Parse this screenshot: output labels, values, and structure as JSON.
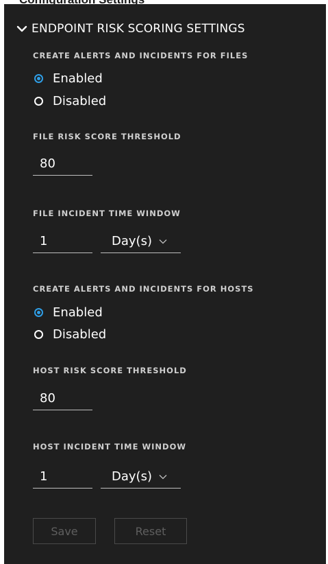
{
  "header": {
    "clipped_text": "Configuration Settings",
    "title": "ENDPOINT RISK SCORING SETTINGS",
    "chevron_icon": "chevron-down-icon"
  },
  "files_alerts": {
    "label": "CREATE ALERTS AND INCIDENTS FOR FILES",
    "options": [
      {
        "label": "Enabled",
        "checked": true
      },
      {
        "label": "Disabled",
        "checked": false
      }
    ]
  },
  "file_threshold": {
    "label": "FILE RISK SCORE THRESHOLD",
    "value": "80"
  },
  "file_window": {
    "label": "FILE INCIDENT TIME WINDOW",
    "value": "1",
    "unit": "Day(s)"
  },
  "hosts_alerts": {
    "label": "CREATE ALERTS AND INCIDENTS FOR HOSTS",
    "options": [
      {
        "label": "Enabled",
        "checked": true
      },
      {
        "label": "Disabled",
        "checked": false
      }
    ]
  },
  "host_threshold": {
    "label": "HOST RISK SCORE THRESHOLD",
    "value": "80"
  },
  "host_window": {
    "label": "HOST INCIDENT TIME WINDOW",
    "value": "1",
    "unit": "Day(s)"
  },
  "buttons": {
    "save": "Save",
    "reset": "Reset",
    "disabled": true
  },
  "colors": {
    "panel_bg": "#1f1f1f",
    "accent": "#2f9ee6",
    "text": "#ffffff",
    "label": "#cfcfcf",
    "disabled_text": "#5f5f5f"
  }
}
